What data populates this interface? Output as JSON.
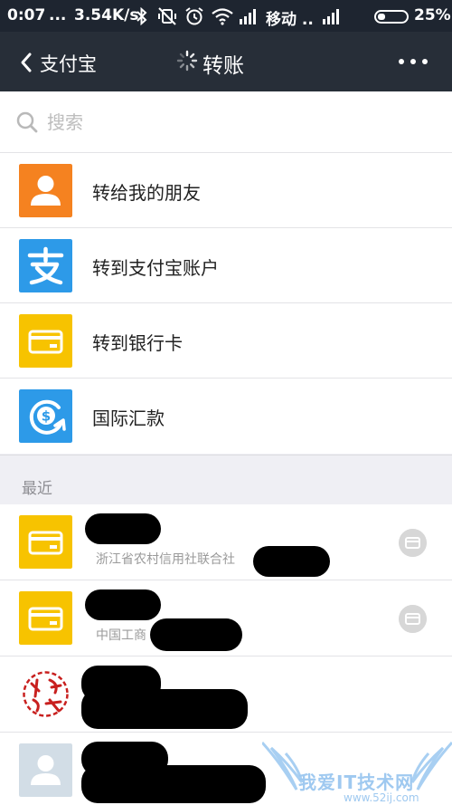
{
  "status_bar": {
    "time": "0:07",
    "dots": "...",
    "speed": "3.54K/s",
    "carrier": "移动 ..",
    "battery": "25%"
  },
  "nav": {
    "back_label": "支付宝",
    "title": "转账"
  },
  "search": {
    "placeholder": "搜索"
  },
  "menu": [
    {
      "label": "转给我的朋友",
      "icon": "contact-icon",
      "color": "#f58220"
    },
    {
      "label": "转到支付宝账户",
      "icon": "alipay-icon",
      "color": "#2d9ae8"
    },
    {
      "label": "转到银行卡",
      "icon": "bank-card-icon",
      "color": "#f7c300"
    },
    {
      "label": "国际汇款",
      "icon": "international-remit-icon",
      "color": "#2d9ae8"
    }
  ],
  "recent_header": "最近",
  "recents": [
    {
      "subtitle": "浙江省农村信用社联合社",
      "icon": "bank-card-icon"
    },
    {
      "subtitle": "中国工商",
      "icon": "bank-card-icon"
    },
    {
      "subtitle": "",
      "icon": "seal-avatar"
    },
    {
      "subtitle": "",
      "icon": "default-avatar-icon"
    }
  ],
  "watermark": {
    "text": "我爱IT技术网",
    "url": "www.52ij.com"
  },
  "colors": {
    "status_bar": "#1e2530",
    "nav_bar": "#272e38",
    "orange": "#f58220",
    "blue": "#2d9ae8",
    "yellow": "#f7c300",
    "background": "#efeff4"
  }
}
